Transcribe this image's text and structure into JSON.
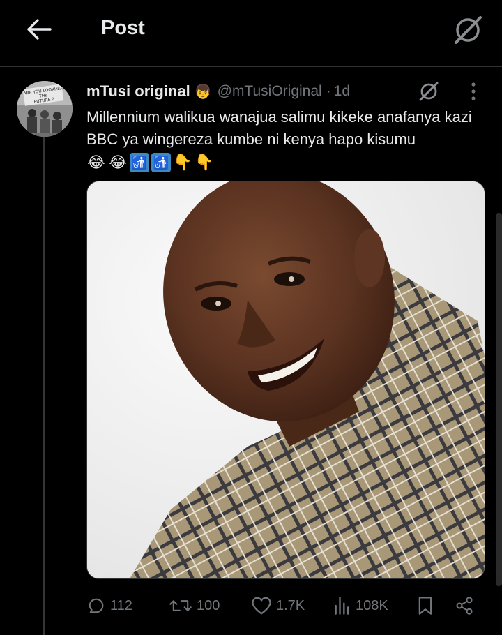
{
  "header": {
    "title": "Post",
    "back_icon": "arrow-left-icon",
    "grok_icon": "grok-icon"
  },
  "post": {
    "display_name": "mTusi original",
    "name_emoji": "👦",
    "handle": "@mTusiOriginal",
    "separator": "·",
    "time": "1d",
    "text": "Millennium walikua wanajua salimu kikeke anafanya kazi BBC ya wingereza kumbe ni kenya hapo kisumu",
    "emojis": [
      "😂",
      "😂",
      "🚮",
      "🚮",
      "👇",
      "👇"
    ],
    "avatar_text": "ARE YOU LOOKING THE FUTURE ?"
  },
  "actions": {
    "replies": "112",
    "reposts": "100",
    "likes": "1.7K",
    "views": "108K"
  },
  "colors": {
    "background": "#000000",
    "text": "#e7e9ea",
    "muted": "#71767b",
    "divider": "#2f3336"
  }
}
